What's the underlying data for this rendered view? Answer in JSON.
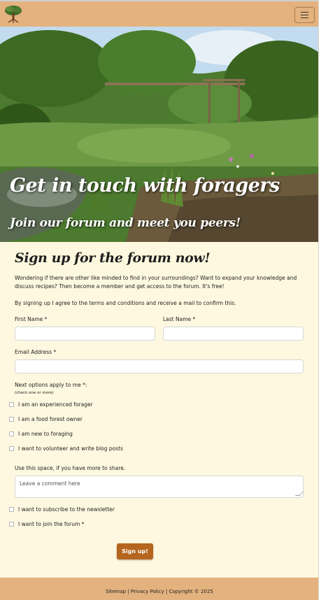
{
  "navbar": {
    "logo_icon": "tree-logo-icon",
    "menu_icon": "hamburger-menu-icon"
  },
  "hero": {
    "title": "Get in touch with foragers",
    "subtitle": "Join our forum and meet you peers!"
  },
  "form": {
    "title": "Sign up for the forum now!",
    "intro": "Wondering if there are other like minded to find in your surroundings? Want to expand your knowledge and discuss recipes? Then become a member and get access to the forum. It's free!",
    "terms": "By signing up I agree to the terms and conditions and receive a mail to confirm this.",
    "first_name_label": "First Name *",
    "first_name_value": "",
    "last_name_label": "Last Name *",
    "last_name_value": "",
    "email_label": "Email Address *",
    "email_value": "",
    "options_label": "Next options apply to me *:",
    "options_hint": "(check one or more)",
    "options": [
      "I am an experienced forager",
      "I am a food forest owner",
      "I am new to foraging",
      "I want to volunteer and write blog posts"
    ],
    "comment_label": "Use this space, if you have more to share.",
    "comment_placeholder": "Leave a comment here",
    "newsletter_label": "I want to subscribe to the newsletter",
    "join_label": "I want to join the forum *",
    "submit_label": "Sign up!"
  },
  "footer": {
    "sitemap": "Sitemap",
    "sep1": " | ",
    "privacy": "Privacy Policy",
    "sep2": " | ",
    "copyright": "Copyright © 2025"
  },
  "colors": {
    "navbar": "#e3b27e",
    "background": "#fdf8df",
    "button": "#b5651d"
  }
}
